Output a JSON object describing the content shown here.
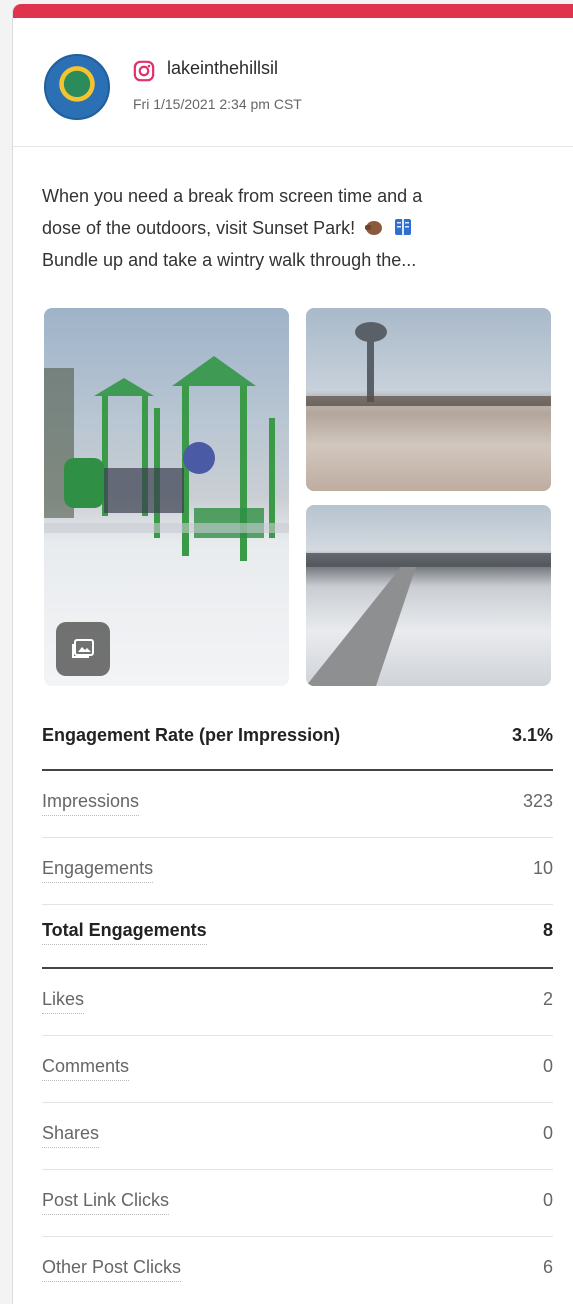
{
  "post": {
    "username": "lakeinthehillsil",
    "network_icon": "instagram-icon",
    "timestamp": "Fri 1/15/2021 2:34 pm CST",
    "text_line1": "When you need a break from screen time and a",
    "text_line2": "dose of the outdoors, visit Sunset Park!",
    "text_line3": "Bundle up and take a wintry walk through the...",
    "emojis": [
      "hand-icon",
      "book-icon"
    ],
    "media_icon": "gallery-icon"
  },
  "colors": {
    "accent": "#e0334d",
    "instagram": "#e1306c"
  },
  "metrics": {
    "engagement_rate_label": "Engagement Rate (per Impression)",
    "engagement_rate_value": "3.1%",
    "impressions_label": "Impressions",
    "impressions_value": "323",
    "engagements_label": "Engagements",
    "engagements_value": "10",
    "total_engagements_label": "Total Engagements",
    "total_engagements_value": "8",
    "likes_label": "Likes",
    "likes_value": "2",
    "comments_label": "Comments",
    "comments_value": "0",
    "shares_label": "Shares",
    "shares_value": "0",
    "post_link_clicks_label": "Post Link Clicks",
    "post_link_clicks_value": "0",
    "other_post_clicks_label": "Other Post Clicks",
    "other_post_clicks_value": "6"
  }
}
